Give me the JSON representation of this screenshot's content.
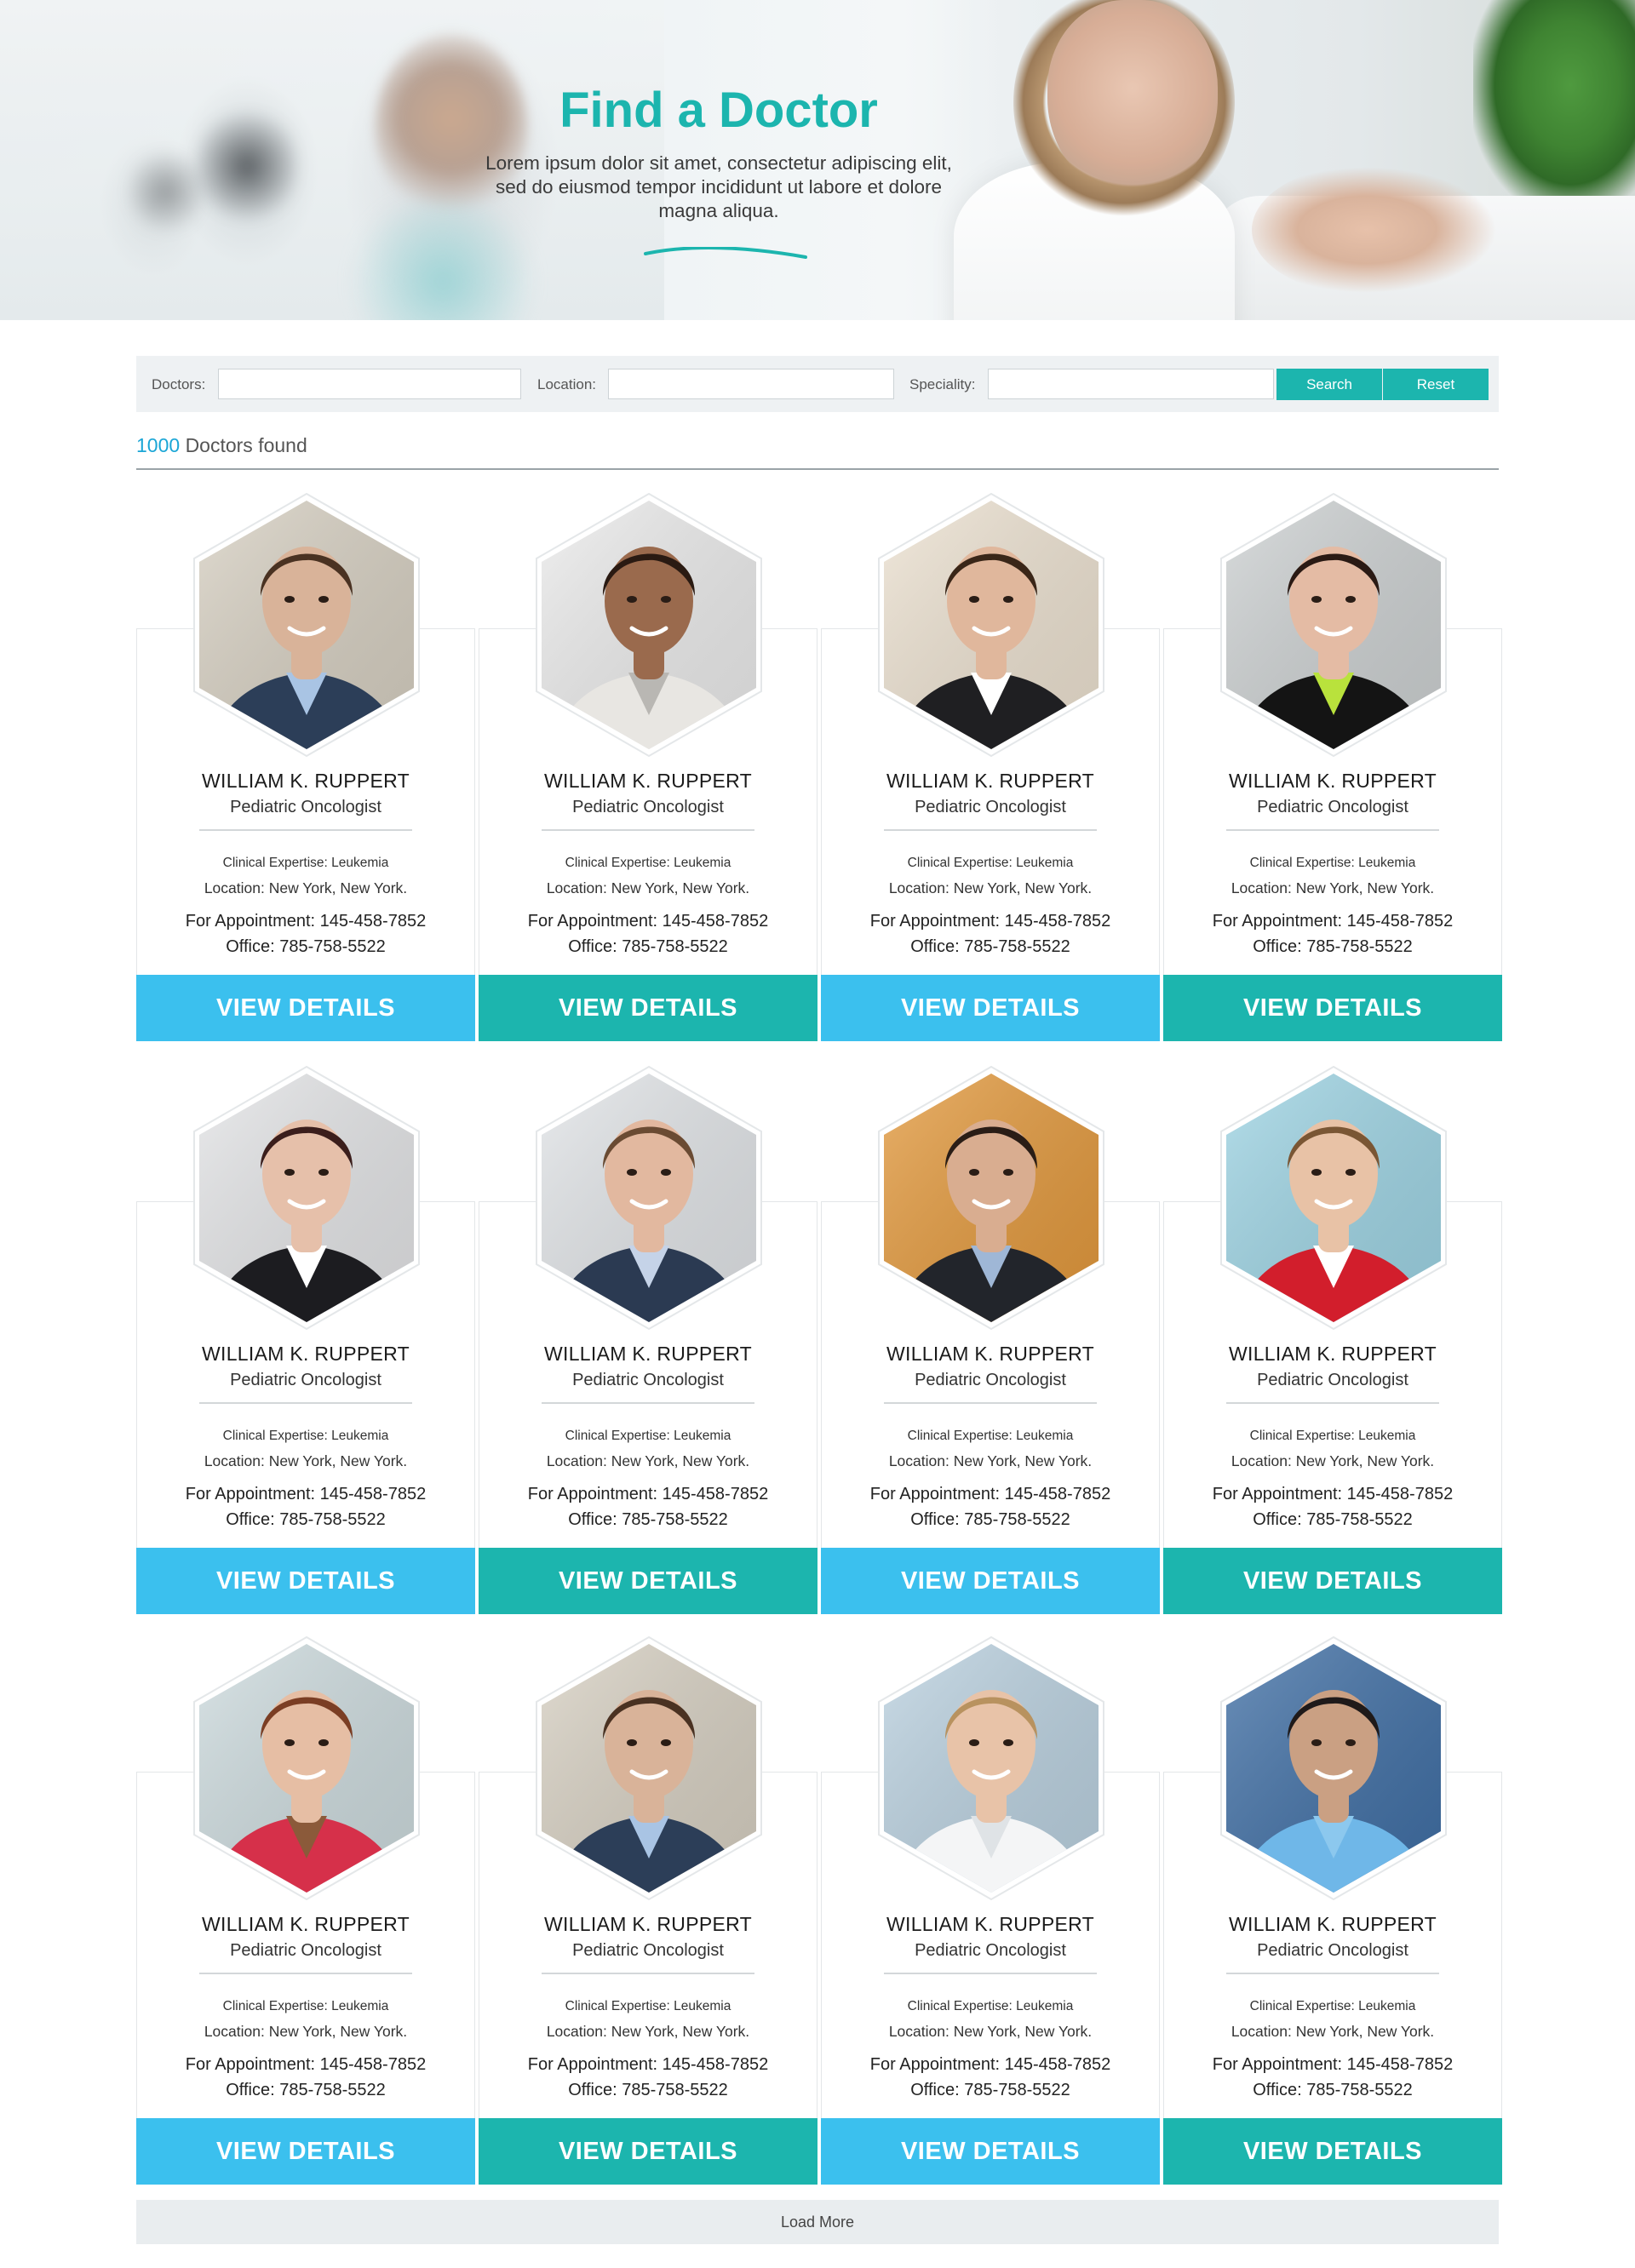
{
  "hero": {
    "title": "Find a Doctor",
    "subtitle": "Lorem ipsum dolor sit amet, consectetur adipiscing elit, sed do eiusmod tempor incididunt ut labore et dolore magna aliqua."
  },
  "search": {
    "doctors_label": "Doctors:",
    "doctors_value": "",
    "location_label": "Location:",
    "location_value": "",
    "speciality_label": "Speciality:",
    "speciality_value": "",
    "search_button": "Search",
    "reset_button": "Reset"
  },
  "results": {
    "count": "1000",
    "suffix": "Doctors found"
  },
  "colors": {
    "accent_teal": "#1cb5ae",
    "accent_blue": "#3bc0ee",
    "count_blue": "#1ba6d6"
  },
  "doctors": [
    {
      "name": "WILLIAM K. RUPPERT",
      "specialty": "Pediatric Oncologist",
      "expertise": "Clinical Expertise: Leukemia",
      "location": "Location: New York, New York.",
      "appointment": "For Appointment: 145-458-7852",
      "office": "Office: 785-758-5522",
      "button": "VIEW DETAILS",
      "button_color": "blue",
      "photo": {
        "skin": "#d9b399",
        "hair": "#4a3222",
        "clothes": "#2c3e58",
        "shirt": "#a9c4e4",
        "bg": "#d9d2c4"
      }
    },
    {
      "name": "WILLIAM K. RUPPERT",
      "specialty": "Pediatric Oncologist",
      "expertise": "Clinical Expertise: Leukemia",
      "location": "Location: New York, New York.",
      "appointment": "For Appointment: 145-458-7852",
      "office": "Office: 785-758-5522",
      "button": "VIEW DETAILS",
      "button_color": "teal",
      "photo": {
        "skin": "#9a6a4d",
        "hair": "#2a1a12",
        "clothes": "#e8e6e2",
        "shirt": "#b9b7b3",
        "bg": "#eeeeee"
      }
    },
    {
      "name": "WILLIAM K. RUPPERT",
      "specialty": "Pediatric Oncologist",
      "expertise": "Clinical Expertise: Leukemia",
      "location": "Location: New York, New York.",
      "appointment": "For Appointment: 145-458-7852",
      "office": "Office: 785-758-5522",
      "button": "VIEW DETAILS",
      "button_color": "blue",
      "photo": {
        "skin": "#e0b79c",
        "hair": "#3a2618",
        "clothes": "#1f1f22",
        "shirt": "#ffffff",
        "bg": "#efe4d3"
      }
    },
    {
      "name": "WILLIAM K. RUPPERT",
      "specialty": "Pediatric Oncologist",
      "expertise": "Clinical Expertise: Leukemia",
      "location": "Location: New York, New York.",
      "appointment": "For Appointment: 145-458-7852",
      "office": "Office: 785-758-5522",
      "button": "VIEW DETAILS",
      "button_color": "teal",
      "photo": {
        "skin": "#e4bba4",
        "hair": "#2a1a14",
        "clothes": "#141414",
        "shirt": "#b9e23c",
        "bg": "#cfd3d4"
      }
    },
    {
      "name": "WILLIAM K. RUPPERT",
      "specialty": "Pediatric Oncologist",
      "expertise": "Clinical Expertise: Leukemia",
      "location": "Location: New York, New York.",
      "appointment": "For Appointment: 145-458-7852",
      "office": "Office: 785-758-5522",
      "button": "VIEW DETAILS",
      "button_color": "blue",
      "photo": {
        "skin": "#e6c0aa",
        "hair": "#3b1e1c",
        "clothes": "#1c1c20",
        "shirt": "#ffffff",
        "bg": "#e6e7e9"
      }
    },
    {
      "name": "WILLIAM K. RUPPERT",
      "specialty": "Pediatric Oncologist",
      "expertise": "Clinical Expertise: Leukemia",
      "location": "Location: New York, New York.",
      "appointment": "For Appointment: 145-458-7852",
      "office": "Office: 785-758-5522",
      "button": "VIEW DETAILS",
      "button_color": "teal",
      "photo": {
        "skin": "#e2b89f",
        "hair": "#6a4b33",
        "clothes": "#2b3a52",
        "shirt": "#c5d3e8",
        "bg": "#e4e7ea"
      }
    },
    {
      "name": "WILLIAM K. RUPPERT",
      "specialty": "Pediatric Oncologist",
      "expertise": "Clinical Expertise: Leukemia",
      "location": "Location: New York, New York.",
      "appointment": "For Appointment: 145-458-7852",
      "office": "Office: 785-758-5522",
      "button": "VIEW DETAILS",
      "button_color": "blue",
      "photo": {
        "skin": "#d9ad90",
        "hair": "#2a1d16",
        "clothes": "#22252b",
        "shirt": "#9fb7d6",
        "bg": "#e59a3c"
      }
    },
    {
      "name": "WILLIAM K. RUPPERT",
      "specialty": "Pediatric Oncologist",
      "expertise": "Clinical Expertise: Leukemia",
      "location": "Location: New York, New York.",
      "appointment": "For Appointment: 145-458-7852",
      "office": "Office: 785-758-5522",
      "button": "VIEW DETAILS",
      "button_color": "teal",
      "photo": {
        "skin": "#e8c2a6",
        "hair": "#7a5634",
        "clothes": "#d21e2c",
        "shirt": "#ffffff",
        "bg": "#9fd6e6"
      }
    },
    {
      "name": "WILLIAM K. RUPPERT",
      "specialty": "Pediatric Oncologist",
      "expertise": "Clinical Expertise: Leukemia",
      "location": "Location: New York, New York.",
      "appointment": "For Appointment: 145-458-7852",
      "office": "Office: 785-758-5522",
      "button": "VIEW DETAILS",
      "button_color": "blue",
      "photo": {
        "skin": "#e6bea4",
        "hair": "#7b3e24",
        "clothes": "#d6304a",
        "shirt": "#8b5a3a",
        "bg": "#cfdde0"
      }
    },
    {
      "name": "WILLIAM K. RUPPERT",
      "specialty": "Pediatric Oncologist",
      "expertise": "Clinical Expertise: Leukemia",
      "location": "Location: New York, New York.",
      "appointment": "For Appointment: 145-458-7852",
      "office": "Office: 785-758-5522",
      "button": "VIEW DETAILS",
      "button_color": "teal",
      "photo": {
        "skin": "#d9b399",
        "hair": "#4a3222",
        "clothes": "#2c3e58",
        "shirt": "#a9c4e4",
        "bg": "#d9d2c4"
      }
    },
    {
      "name": "WILLIAM K. RUPPERT",
      "specialty": "Pediatric Oncologist",
      "expertise": "Clinical Expertise: Leukemia",
      "location": "Location: New York, New York.",
      "appointment": "For Appointment: 145-458-7852",
      "office": "Office: 785-758-5522",
      "button": "VIEW DETAILS",
      "button_color": "blue",
      "photo": {
        "skin": "#e8c3a8",
        "hair": "#b8925f",
        "clothes": "#f4f5f6",
        "shirt": "#dfe3e6",
        "bg": "#bcd3e2"
      }
    },
    {
      "name": "WILLIAM K. RUPPERT",
      "specialty": "Pediatric Oncologist",
      "expertise": "Clinical Expertise: Leukemia",
      "location": "Location: New York, New York.",
      "appointment": "For Appointment: 145-458-7852",
      "office": "Office: 785-758-5522",
      "button": "VIEW DETAILS",
      "button_color": "teal",
      "photo": {
        "skin": "#caa083",
        "hair": "#1f1a1a",
        "clothes": "#6fb7e8",
        "shirt": "#8cc8ee",
        "bg": "#3f6fa6"
      }
    }
  ],
  "load_more": "Load More"
}
